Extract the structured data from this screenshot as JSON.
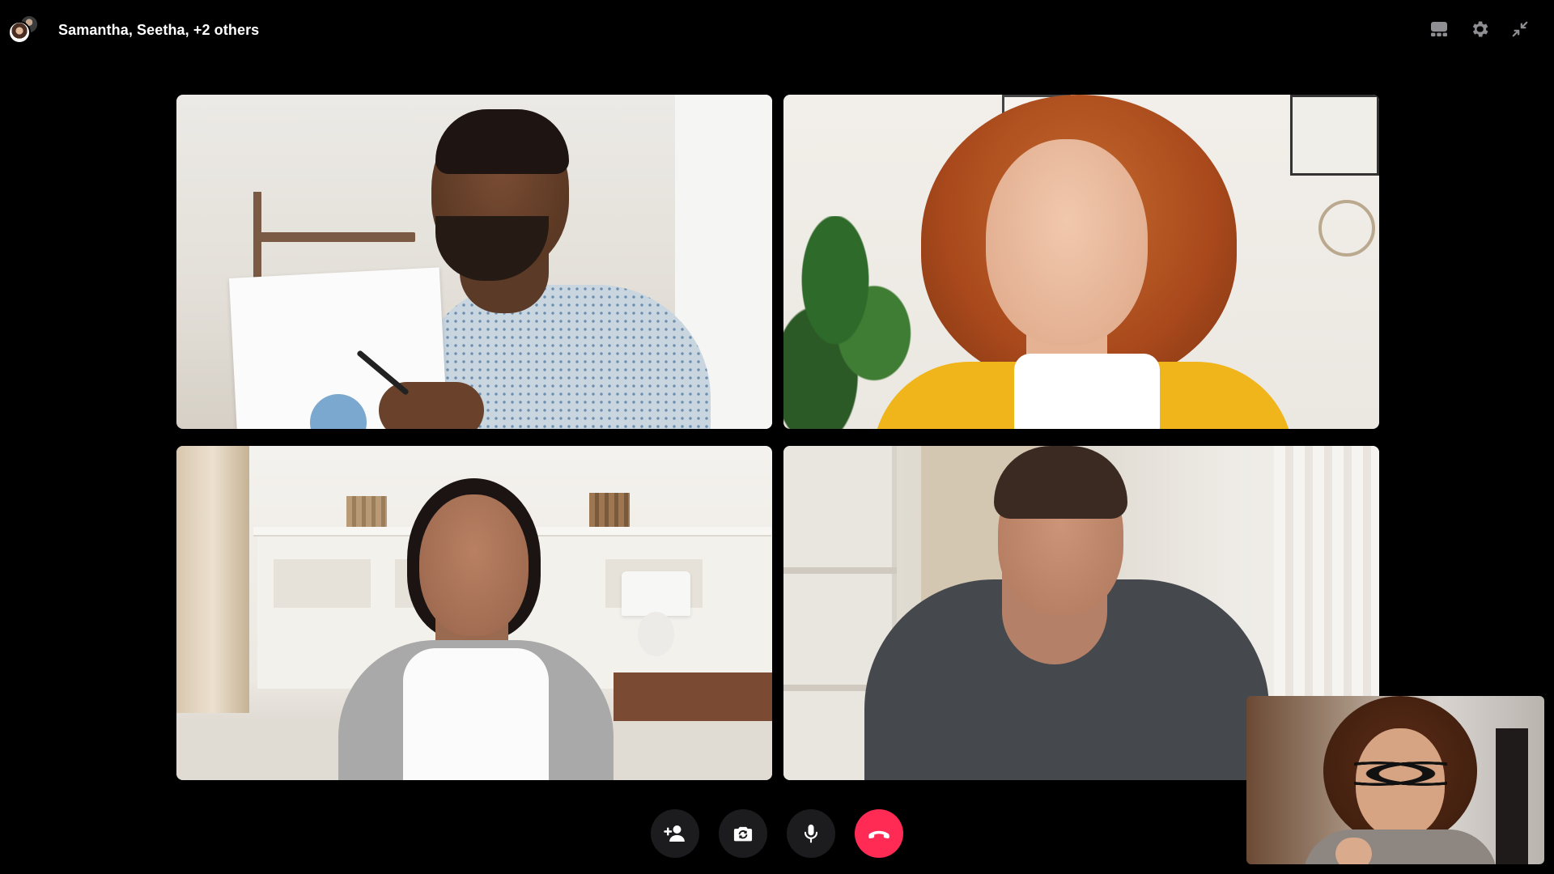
{
  "call": {
    "title": "Samantha, Seetha, +2 others"
  },
  "top_actions": [
    {
      "icon": "layout-icon"
    },
    {
      "icon": "gear-icon"
    },
    {
      "icon": "minimize-icon"
    }
  ],
  "participants": [
    {
      "tile": "video-tile-1"
    },
    {
      "tile": "video-tile-2"
    },
    {
      "tile": "video-tile-3"
    },
    {
      "tile": "video-tile-4"
    }
  ],
  "controls": [
    {
      "icon": "add-person-icon"
    },
    {
      "icon": "flip-camera-icon"
    },
    {
      "icon": "microphone-icon"
    },
    {
      "icon": "end-call-icon"
    }
  ],
  "colors": {
    "background": "#000000",
    "control_bg": "#1c1c1e",
    "end_call": "#ff2b55",
    "text": "#ffffff"
  }
}
